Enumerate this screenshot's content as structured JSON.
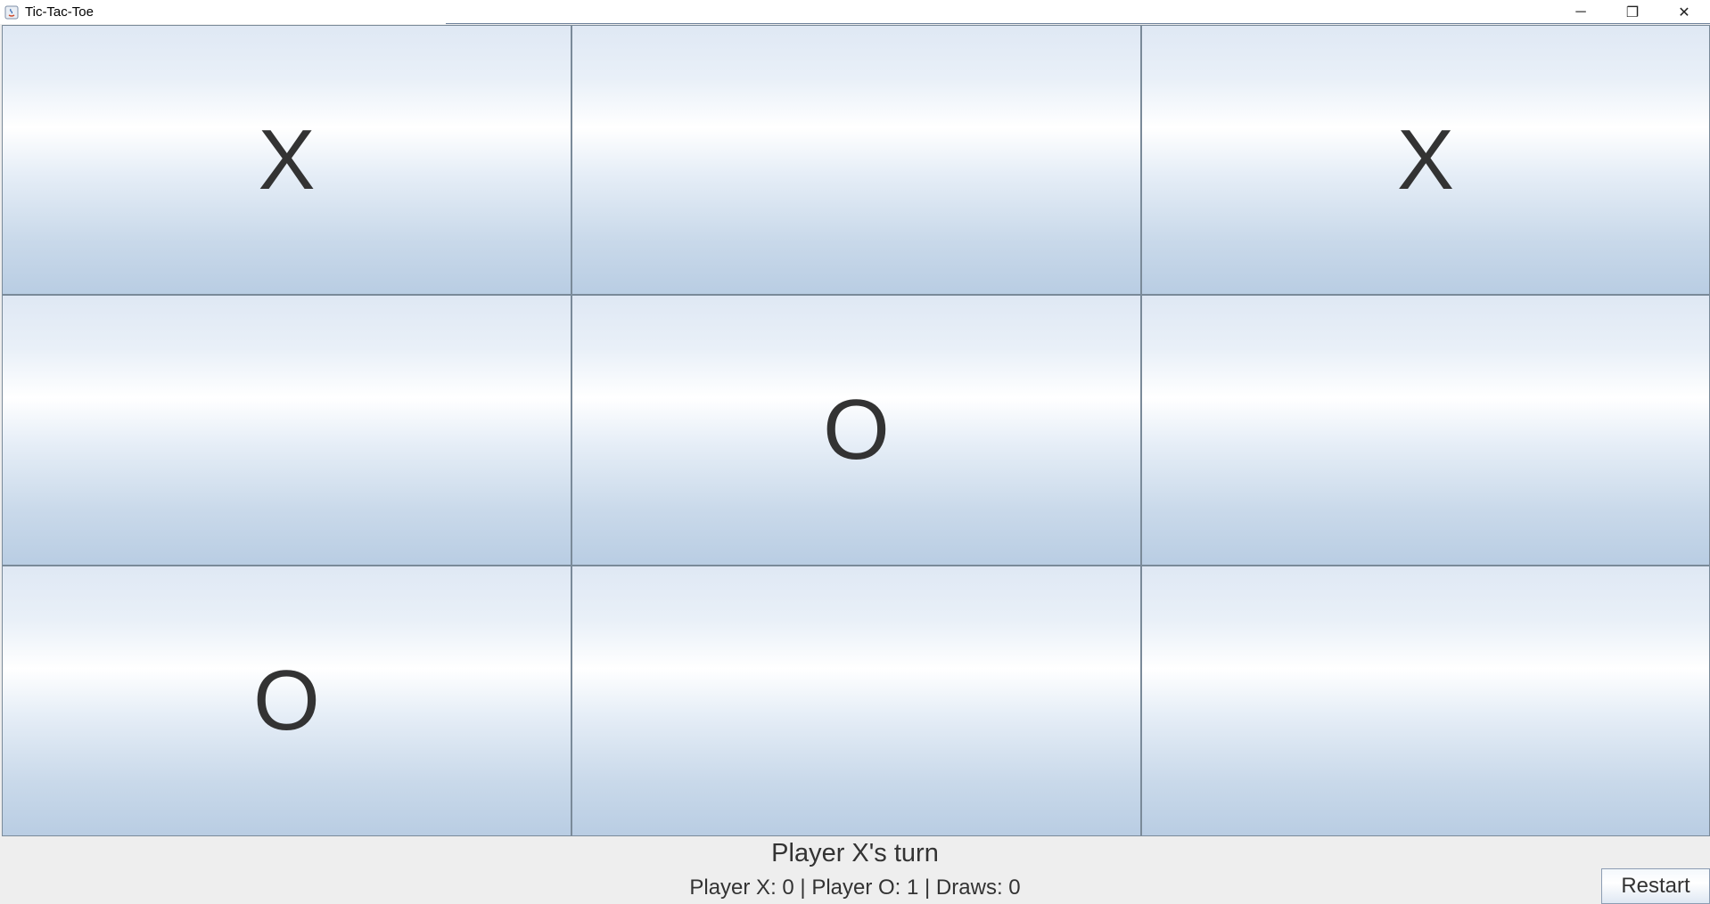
{
  "window": {
    "title": "Tic-Tac-Toe",
    "controls": {
      "minimize": "─",
      "restore": "❐",
      "close": "✕"
    }
  },
  "board": {
    "cells": [
      "X",
      "",
      "X",
      "",
      "O",
      "",
      "O",
      "",
      ""
    ]
  },
  "status": {
    "turn": "Player X's turn",
    "score": "Player X: 0 | Player O: 1 | Draws: 0"
  },
  "buttons": {
    "restart": "Restart"
  },
  "colors": {
    "mark": "#333333",
    "cell_border": "#7a8a99",
    "cell_gradient_top": "#dfe8f4",
    "cell_gradient_mid": "#ffffff",
    "cell_gradient_bottom": "#b9cde3"
  }
}
